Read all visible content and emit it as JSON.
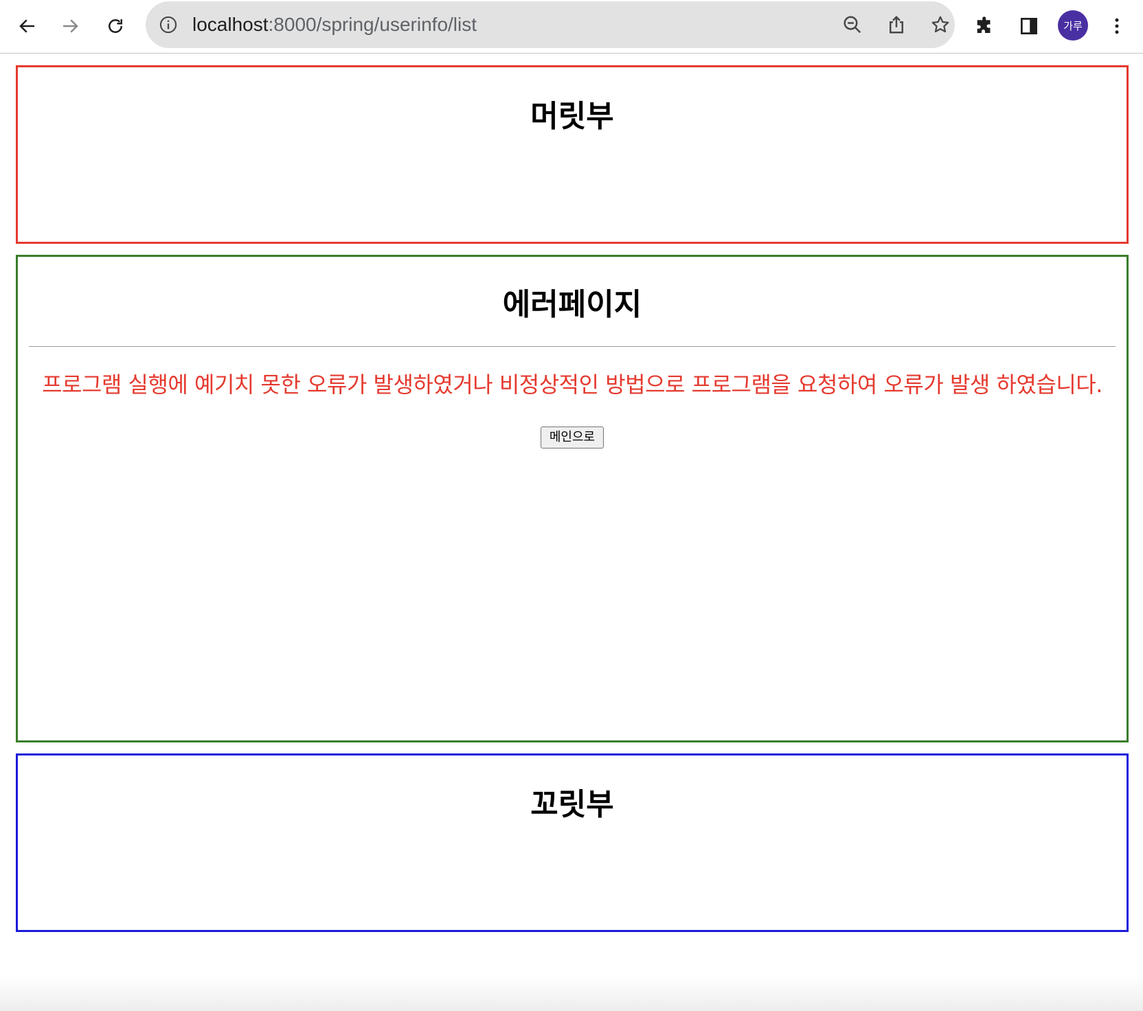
{
  "browser": {
    "url_host": "localhost",
    "url_path": ":8000/spring/userinfo/list",
    "profile_initials": "가루",
    "icons": {
      "back": "back-arrow-icon",
      "forward": "forward-arrow-icon",
      "reload": "reload-icon",
      "info": "info-icon",
      "zoom": "zoom-out-icon",
      "share": "share-icon",
      "bookmark": "star-icon",
      "extensions": "puzzle-icon",
      "side_panel": "side-panel-icon",
      "menu": "kebab-menu-icon"
    }
  },
  "header": {
    "title": "머릿부",
    "border_color": "#e53a2f"
  },
  "content": {
    "title": "에러페이지",
    "error_message": "프로그램 실행에 예기치 못한 오류가 발생하였거나 비정상적인 방법으로 프로그램을 요청하여 오류가 발생 하였습니다.",
    "main_button_label": "메인으로",
    "border_color": "#3a7d2a",
    "message_color": "#e53a2f"
  },
  "footer": {
    "title": "꼬릿부",
    "border_color": "#1a1adb"
  }
}
